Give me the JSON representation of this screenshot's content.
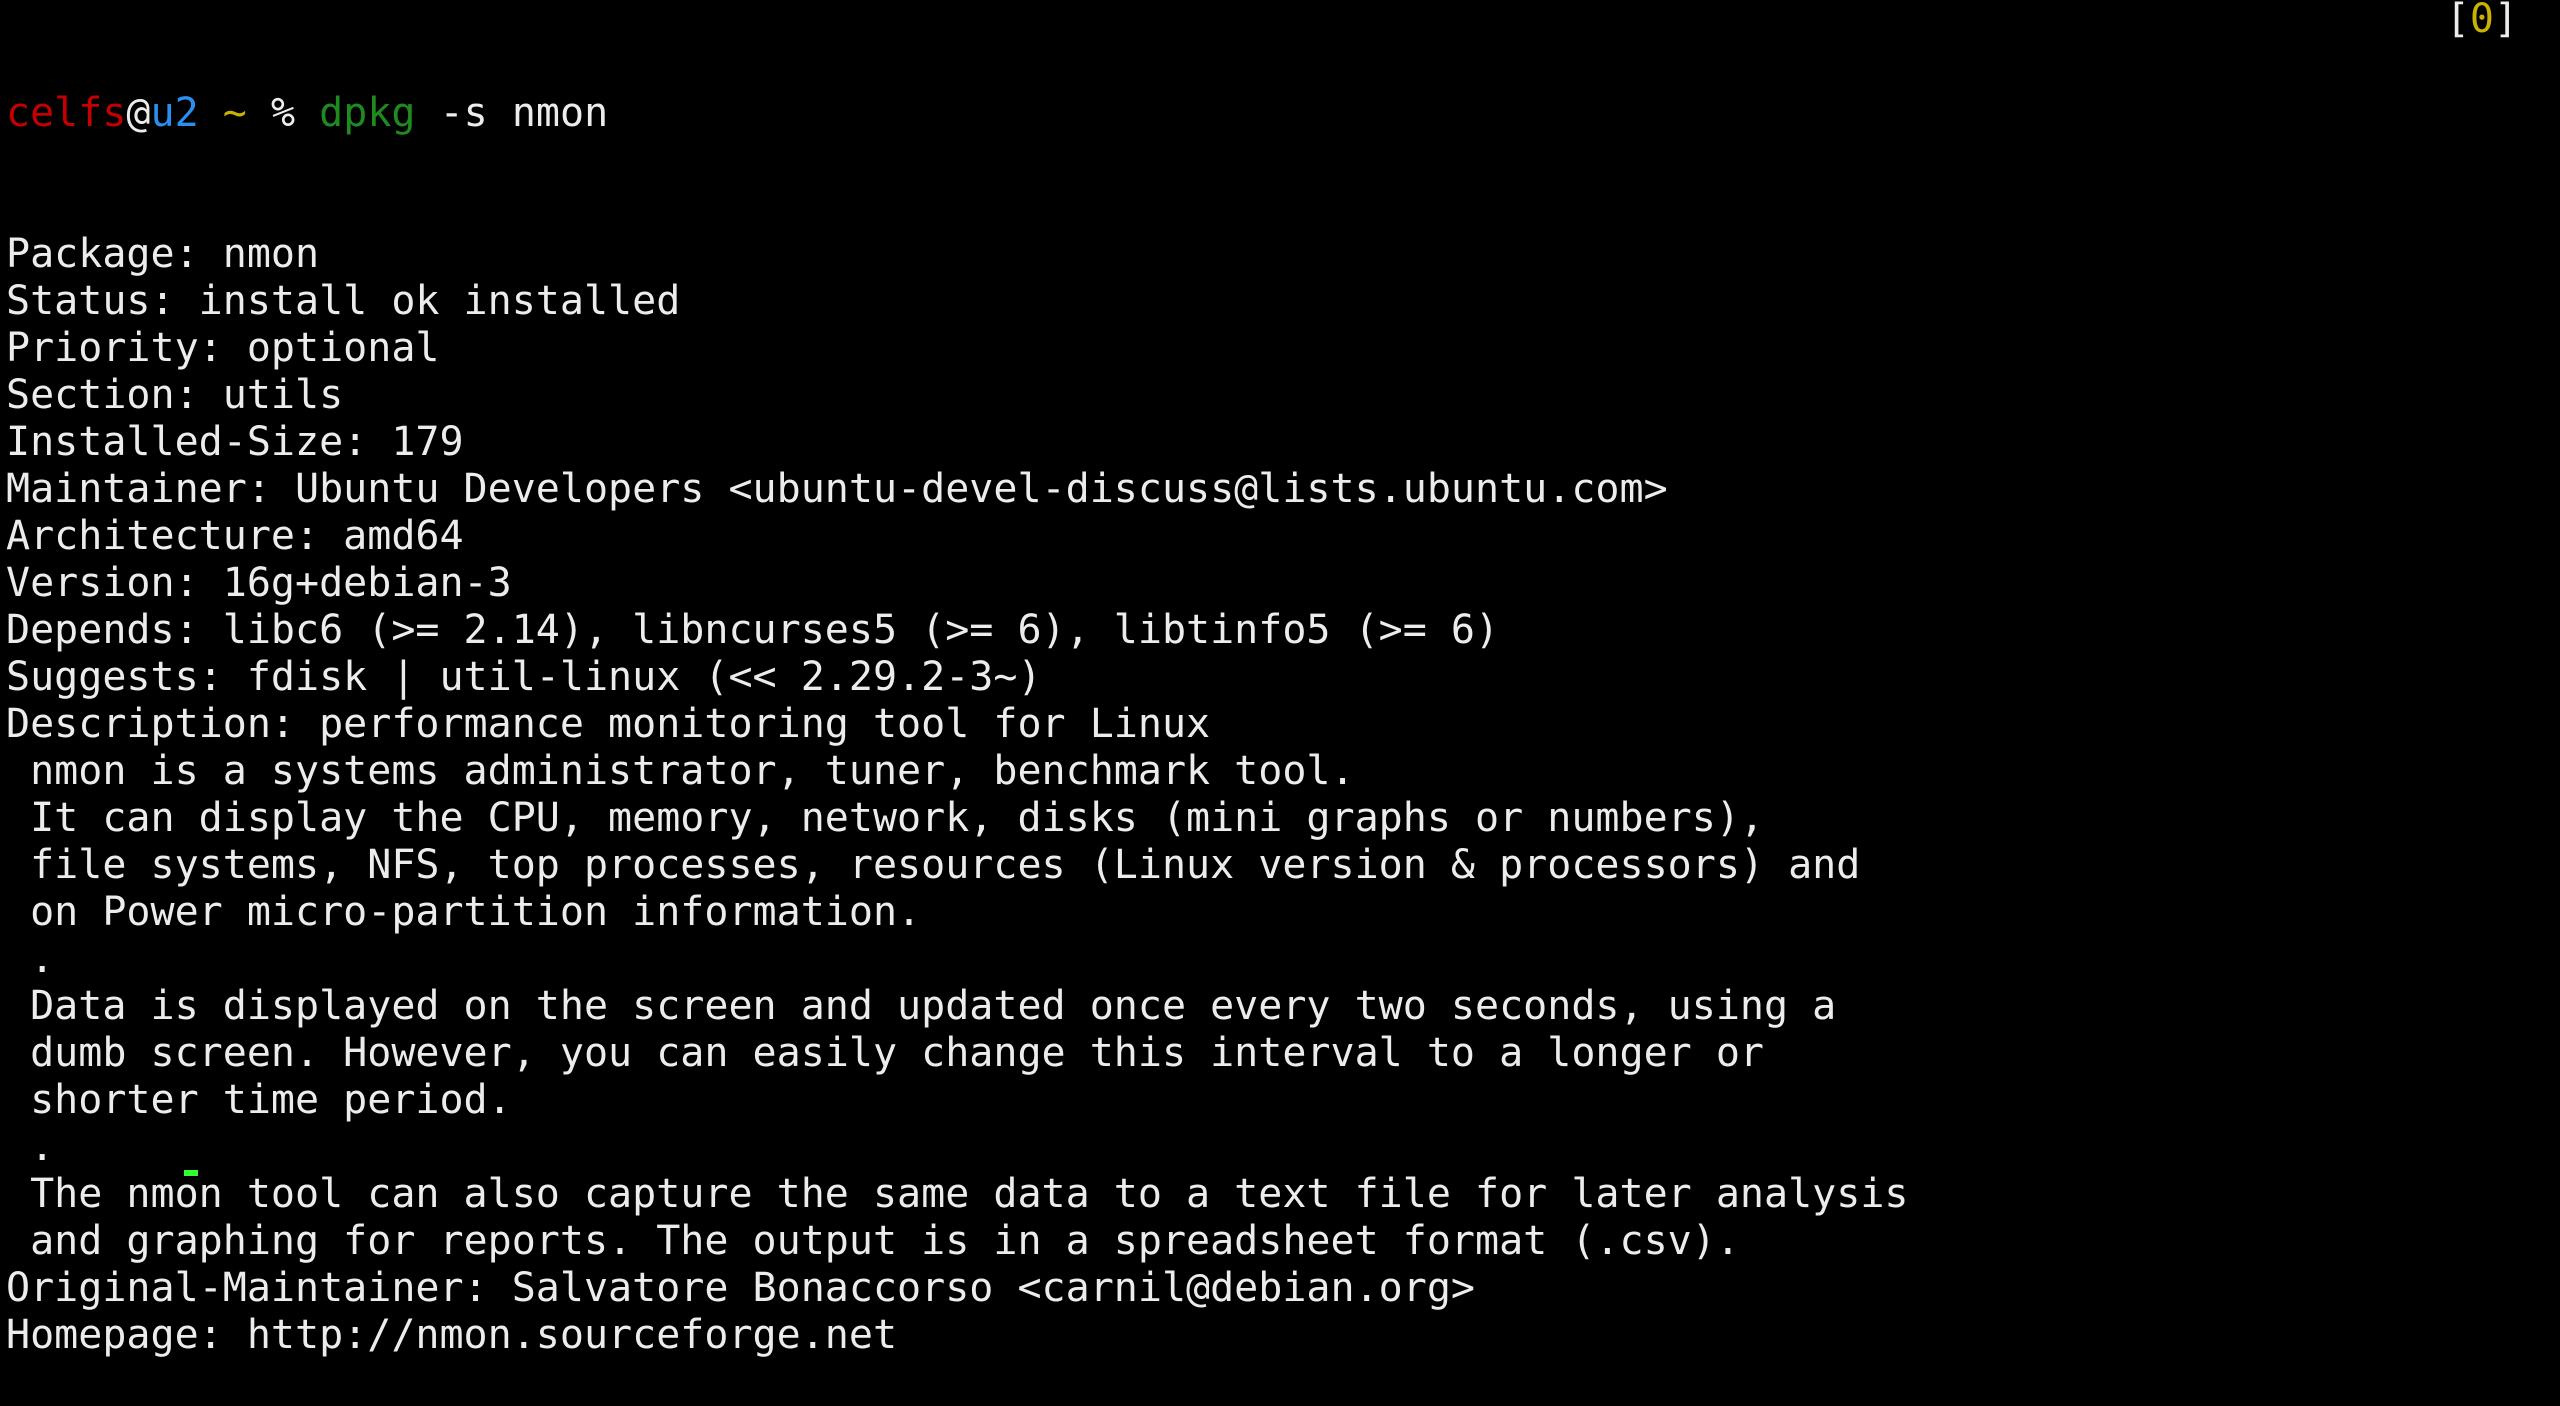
{
  "prompt": {
    "user": "celfs",
    "at": "@",
    "host": "u2",
    "cwd": "~",
    "symbol": "%",
    "command": "dpkg",
    "args": "-s nmon"
  },
  "window_indicator": {
    "open": "[",
    "index": "0",
    "close": "]"
  },
  "output_lines": [
    "Package: nmon",
    "Status: install ok installed",
    "Priority: optional",
    "Section: utils",
    "Installed-Size: 179",
    "Maintainer: Ubuntu Developers <ubuntu-devel-discuss@lists.ubuntu.com>",
    "Architecture: amd64",
    "Version: 16g+debian-3",
    "Depends: libc6 (>= 2.14), libncurses5 (>= 6), libtinfo5 (>= 6)",
    "Suggests: fdisk | util-linux (<< 2.29.2-3~)",
    "Description: performance monitoring tool for Linux",
    " nmon is a systems administrator, tuner, benchmark tool.",
    " It can display the CPU, memory, network, disks (mini graphs or numbers),",
    " file systems, NFS, top processes, resources (Linux version & processors) and",
    " on Power micro-partition information.",
    " .",
    " Data is displayed on the screen and updated once every two seconds, using a",
    " dumb screen. However, you can easily change this interval to a longer or",
    " shorter time period.",
    " .",
    " The nmon tool can also capture the same data to a text file for later analysis",
    " and graphing for reports. The output is in a spreadsheet format (.csv).",
    "Original-Maintainer: Salvatore Bonaccorso <carnil@debian.org>",
    "Homepage: http://nmon.sourceforge.net"
  ]
}
